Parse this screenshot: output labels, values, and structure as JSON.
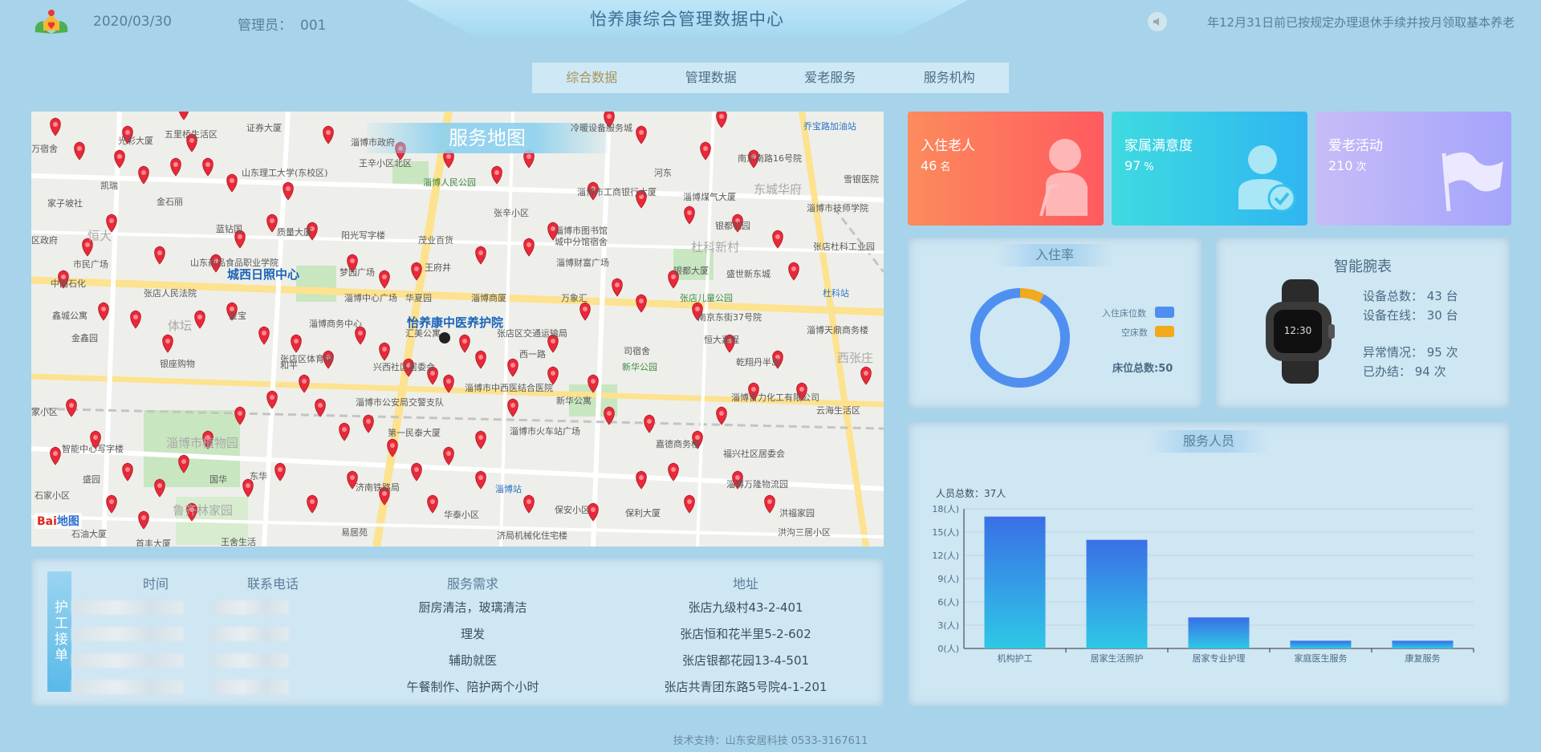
{
  "header": {
    "date": "2020/03/30",
    "admin_label": "管理员：",
    "admin_id": "001",
    "title": "怡养康综合管理数据中心",
    "marquee": "年12月31日前已按规定办理退休手续并按月领取基本养老",
    "logo_icon": "house-heart-logo",
    "speaker_icon": "speaker-mute-icon"
  },
  "tabs": [
    {
      "label": "综合数据",
      "active": true
    },
    {
      "label": "管理数据",
      "active": false
    },
    {
      "label": "爱老服务",
      "active": false
    },
    {
      "label": "服务机构",
      "active": false
    }
  ],
  "map": {
    "title": "服务地图",
    "labels": {
      "center": "怡养康中医养护院",
      "rizhao": "城西日照中心",
      "baidu": "Bai",
      "baidu2": "地图",
      "l1": "五里桥生活区",
      "l2": "光彩大厦",
      "l3": "证券大厦",
      "l4": "淄博市政府",
      "l5": "冷暖设备服务城",
      "l6": "乔宝路加油站",
      "l7": "王辛小区北区",
      "l8": "淄博人民公园",
      "l9": "山东理工大学(东校区)",
      "l10": "凯瑞",
      "l11": "家子坡社",
      "l12": "金石丽",
      "l13": "恒大",
      "l14": "蓝钻国",
      "l15": "质量大厦",
      "l16": "阳光写字楼",
      "l17": "茂业百货",
      "l18": "张辛小区",
      "l19": "淄博市图书馆",
      "l20": "城中分馆宿舍",
      "l21": "淄博市工商银行大厦",
      "l22": "河东",
      "l23": "淄博煤气大厦",
      "l24": "东城华府",
      "l25": "南京南路16号院",
      "l26": "雪银医院",
      "l27": "淄博市技师学院",
      "l28": "银都花园",
      "l29": "杜科新村",
      "l30": "张店杜科工业园",
      "l31": "市民广场",
      "l32": "中国石化",
      "l33": "山东药品食品职业学院",
      "l34": "梦园广场",
      "l35": "王府井",
      "l36": "淄博财富广场",
      "l37": "银都大厦",
      "l38": "盛世新东城",
      "l39": "杜科站",
      "l40": "张店人民法院",
      "l41": "淄博中心广场",
      "l42": "华夏园",
      "l43": "淄博商厦",
      "l44": "万象汇",
      "l45": "张店儿童公园",
      "l46": "南京东街37号院",
      "l47": "鑫城公寓",
      "l48": "体坛",
      "l49": "金宝",
      "l50": "淄博商务中心",
      "l51": "汇美公寓",
      "l52": "张店区交通运输局",
      "l53": "西一路",
      "l54": "司宿舍",
      "l55": "恒大嘉程",
      "l56": "淄博天鼎商务楼",
      "l57": "金鑫园",
      "l58": "银座购物",
      "l59": "张店区体育馆",
      "l60": "兴西社区居委会",
      "l61": "新华公园",
      "l62": "乾翔丹半岛",
      "l63": "西张庄",
      "l64": "淄博市中西医结合医院",
      "l65": "淄博合力化工有限公司",
      "l66": "云海生活区",
      "l67": "家小区",
      "l68": "淄博市植物园",
      "l69": "淄博市公安局交警支队",
      "l70": "新华公寓",
      "l71": "第一民泰大厦",
      "l72": "淄博市火车站广场",
      "l73": "嘉德商务楼",
      "l74": "福兴社区居委会",
      "l75": "智能中心写字楼",
      "l76": "国华",
      "l77": "东华",
      "l78": "济南铁路局",
      "l79": "淄博站",
      "l80": "淄博万隆物流园",
      "l81": "石家小区",
      "l82": "鲁齐林家园",
      "l83": "华泰小区",
      "l84": "保安小区",
      "l85": "保利大厦",
      "l86": "洪福家园",
      "l87": "洪沟三居小区",
      "l88": "石油大厦",
      "l89": "首丰大厦",
      "l90": "王舍生活",
      "l91": "易居苑",
      "l92": "济局机械化住宅楼",
      "l93": "区政府",
      "l94": "盛园",
      "l95": "和平",
      "l96": "万宿舍"
    }
  },
  "orders": {
    "tag": "护工接单",
    "headers": [
      "时间",
      "联系电话",
      "服务需求",
      "地址"
    ],
    "rows": [
      {
        "need": "厨房清洁，玻璃清洁",
        "address": "张店九级村43-2-401"
      },
      {
        "need": "理发",
        "address": "张店恒和花半里5-2-602"
      },
      {
        "need": "辅助就医",
        "address": "张店银都花园13-4-501"
      },
      {
        "need": "午餐制作、陪护两个小时",
        "address": "张店共青团东路5号院4-1-201"
      }
    ]
  },
  "cards": [
    {
      "title": "入住老人",
      "value": "46",
      "unit": "名",
      "icon": "elderly-with-cane-icon"
    },
    {
      "title": "家属满意度",
      "value": "97",
      "unit": "%",
      "icon": "user-check-icon"
    },
    {
      "title": "爱老活动",
      "value": "210",
      "unit": "次",
      "icon": "flag-icon"
    }
  ],
  "occupancy": {
    "title": "入住率",
    "legend_occupied": "入住床位数",
    "legend_empty": "空床数",
    "total_label": "床位总数:50",
    "occupied": 46,
    "empty": 4,
    "color_occupied": "#4f8ff0",
    "color_empty": "#f2a91d"
  },
  "watch": {
    "title": "智能腕表",
    "lines": [
      "设备总数：  43 台",
      "设备在线：  30 台",
      "异常情况：  95 次",
      "已办结：  94 次"
    ],
    "icon": "smartwatch-icon"
  },
  "staff": {
    "title": "服务人员",
    "total_label": "人员总数：37人",
    "chart_data": {
      "type": "bar",
      "categories": [
        "机构护工",
        "居家生活照护",
        "居家专业护理",
        "家庭医生服务",
        "康复服务"
      ],
      "values": [
        17,
        14,
        4,
        1,
        1
      ],
      "ylim": [
        0,
        18
      ],
      "yticks": [
        "0(人)",
        "3(人)",
        "6(人)",
        "9(人)",
        "12(人)",
        "15(人)",
        "18(人)"
      ],
      "bar_color_top": "#3a6fe6",
      "bar_color_bottom": "#2ec8e6"
    }
  },
  "footer": "技术支持：山东安居科技    0533-3167611"
}
